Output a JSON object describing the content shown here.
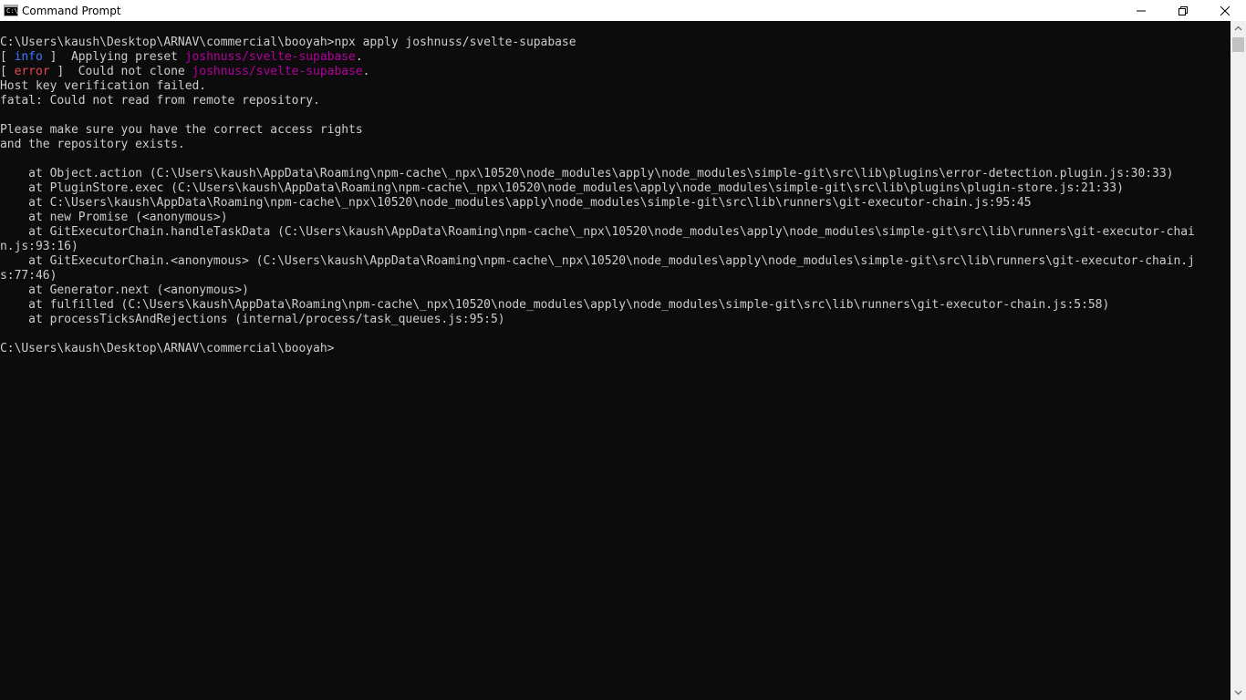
{
  "window": {
    "title": "Command Prompt",
    "app_icon_text": "C:\\",
    "icons": {
      "minimize": "minimize-icon",
      "maximize": "restore-icon",
      "close": "close-icon"
    }
  },
  "colors": {
    "background": "#0c0c0c",
    "foreground": "#cccccc",
    "info": "#3b78ff",
    "error": "#e74856",
    "repo": "#b4009e"
  },
  "console": {
    "command_line": "C:\\Users\\kaush\\Desktop\\ARNAV\\commercial\\booyah>npx apply joshnuss/svelte-supabase",
    "info_line": {
      "open": "[ ",
      "tag": "info",
      "close": " ]  Applying preset ",
      "repo": "joshnuss/svelte-supabase",
      "end": "."
    },
    "error_line": {
      "open": "[ ",
      "tag": "error",
      "close": " ]  Could not clone ",
      "repo": "joshnuss/svelte-supabase",
      "end": "."
    },
    "output_lines": [
      "Host key verification failed.",
      "fatal: Could not read from remote repository.",
      "",
      "Please make sure you have the correct access rights",
      "and the repository exists.",
      "",
      "    at Object.action (C:\\Users\\kaush\\AppData\\Roaming\\npm-cache\\_npx\\10520\\node_modules\\apply\\node_modules\\simple-git\\src\\lib\\plugins\\error-detection.plugin.js:30:33)",
      "    at PluginStore.exec (C:\\Users\\kaush\\AppData\\Roaming\\npm-cache\\_npx\\10520\\node_modules\\apply\\node_modules\\simple-git\\src\\lib\\plugins\\plugin-store.js:21:33)",
      "    at C:\\Users\\kaush\\AppData\\Roaming\\npm-cache\\_npx\\10520\\node_modules\\apply\\node_modules\\simple-git\\src\\lib\\runners\\git-executor-chain.js:95:45",
      "    at new Promise (<anonymous>)",
      "    at GitExecutorChain.handleTaskData (C:\\Users\\kaush\\AppData\\Roaming\\npm-cache\\_npx\\10520\\node_modules\\apply\\node_modules\\simple-git\\src\\lib\\runners\\git-executor-chai",
      "n.js:93:16)",
      "    at GitExecutorChain.<anonymous> (C:\\Users\\kaush\\AppData\\Roaming\\npm-cache\\_npx\\10520\\node_modules\\apply\\node_modules\\simple-git\\src\\lib\\runners\\git-executor-chain.j",
      "s:77:46)",
      "    at Generator.next (<anonymous>)",
      "    at fulfilled (C:\\Users\\kaush\\AppData\\Roaming\\npm-cache\\_npx\\10520\\node_modules\\apply\\node_modules\\simple-git\\src\\lib\\runners\\git-executor-chain.js:5:58)",
      "    at processTicksAndRejections (internal/process/task_queues.js:95:5)",
      "",
      "C:\\Users\\kaush\\Desktop\\ARNAV\\commercial\\booyah>"
    ]
  }
}
